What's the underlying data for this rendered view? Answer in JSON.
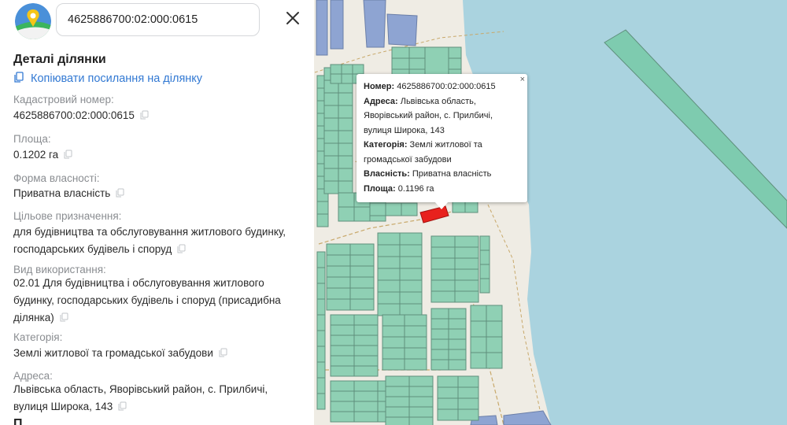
{
  "search": {
    "value": "4625886700:02:000:0615"
  },
  "panel": {
    "title": "Деталі ділянки",
    "copy_link": "Копіювати посилання на ділянку",
    "fields": [
      {
        "label": "Кадастровий номер:",
        "value": "4625886700:02:000:0615"
      },
      {
        "label": "Площа:",
        "value": "0.1202 га"
      },
      {
        "label": "Форма власності:",
        "value": "Приватна власність"
      },
      {
        "label": "Цільове призначення:",
        "value_lines": [
          "для будівництва та обслуговування житлового будинку,",
          "господарських будівель і споруд"
        ]
      },
      {
        "label": "Вид використання:",
        "value_lines": [
          "02.01 Для будівництва і обслуговування житлового",
          "будинку, господарських будівель і споруд (присадибна",
          "ділянка)"
        ]
      },
      {
        "label": "Категорія:",
        "value": "Землі житлової та громадської забудови"
      },
      {
        "label": "Адреса:",
        "value_lines": [
          "Львівська область, Яворівський район, с. Прилбичі,",
          "вулиця Широка, 143"
        ]
      }
    ],
    "cutoff_text": "П..."
  },
  "popup": {
    "close": "×",
    "number_label": "Номер:",
    "number": "4625886700:02:000:0615",
    "address_label": "Адреса:",
    "address_1": "Львівська область,",
    "address_2": "Яворівський район, с. Прилбичі,",
    "address_3": "вулиця Широка, 143",
    "category_label": "Категорія:",
    "category_1": "Землі житлової та",
    "category_2": "громадської забудови",
    "ownership_label": "Власність:",
    "ownership": "Приватна власність",
    "area_label": "Площа:",
    "area": "0.1196 га"
  },
  "map": {
    "colors": {
      "land": "#efece4",
      "water": "#aad3df",
      "parcel": "#8fd0b4",
      "parcel_border": "#5f8f7c",
      "state_parcel": "#8ea4d2",
      "selected": "#e8211d",
      "road": "#c8a86a"
    }
  }
}
